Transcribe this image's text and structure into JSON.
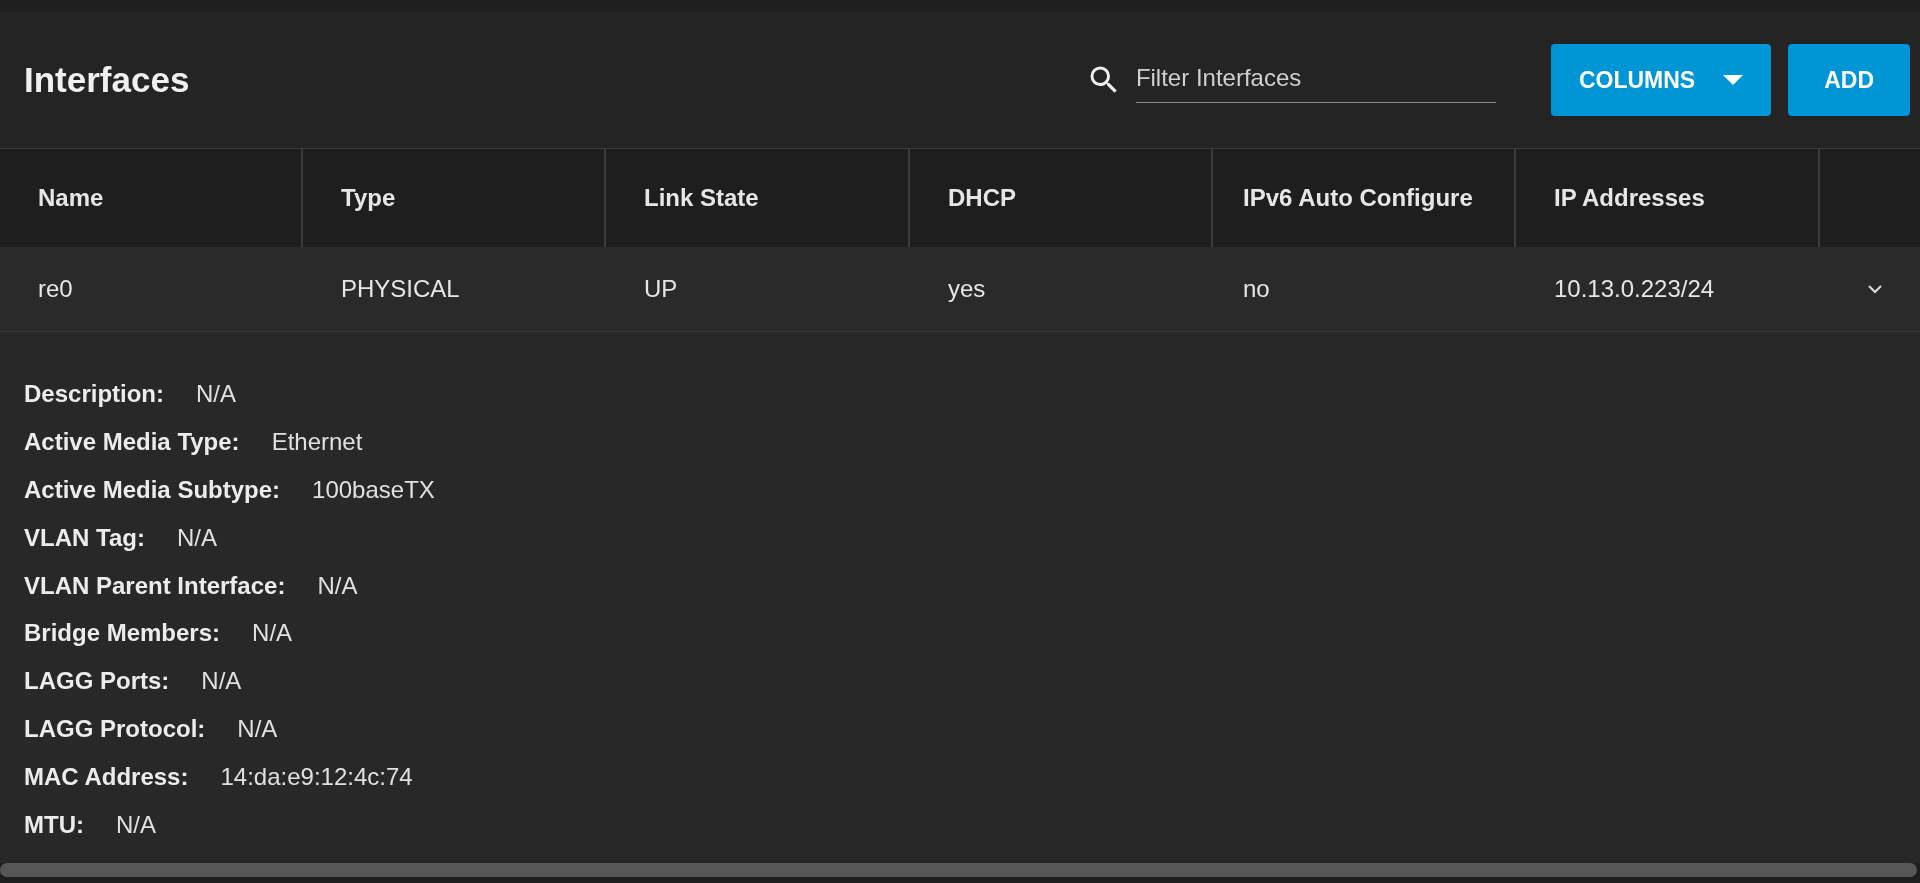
{
  "title": "Interfaces",
  "search": {
    "placeholder": "Filter Interfaces"
  },
  "buttons": [
    {
      "label": "COLUMNS",
      "kind": "dropdown"
    },
    {
      "label": "ADD",
      "kind": "plain"
    }
  ],
  "table": {
    "columns": [
      "Name",
      "Type",
      "Link State",
      "DHCP",
      "IPv6 Auto Configure",
      "IP Addresses"
    ],
    "rows": [
      {
        "cells": [
          "re0",
          "PHYSICAL",
          "UP",
          "yes",
          "no",
          "10.13.0.223/24"
        ],
        "expanded": true,
        "details": [
          {
            "label": "Description:",
            "value": "N/A"
          },
          {
            "label": "Active Media Type:",
            "value": "Ethernet"
          },
          {
            "label": "Active Media Subtype:",
            "value": "100baseTX"
          },
          {
            "label": "VLAN Tag:",
            "value": "N/A"
          },
          {
            "label": "VLAN Parent Interface:",
            "value": "N/A"
          },
          {
            "label": "Bridge Members:",
            "value": "N/A"
          },
          {
            "label": "LAGG Ports:",
            "value": "N/A"
          },
          {
            "label": "LAGG Protocol:",
            "value": "N/A"
          },
          {
            "label": "MAC Address:",
            "value": "14:da:e9:12:4c:74"
          },
          {
            "label": "MTU:",
            "value": "N/A"
          }
        ]
      }
    ]
  }
}
